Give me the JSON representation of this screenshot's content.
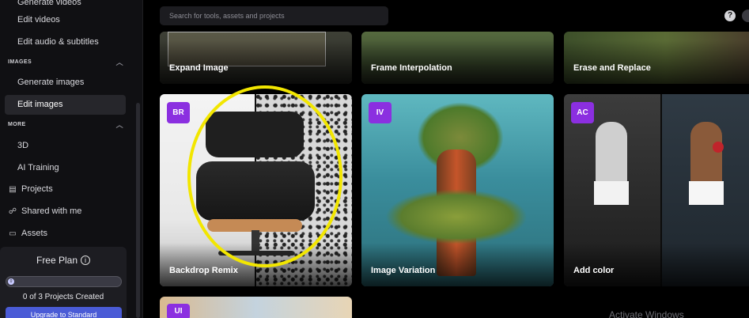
{
  "sidebar": {
    "cut_item": "Generate videos",
    "items_top": [
      "Edit videos",
      "Edit audio & subtitles"
    ],
    "images_section": "IMAGES",
    "images_items": [
      "Generate images",
      "Edit images"
    ],
    "more_section": "MORE",
    "more_items": [
      "3D",
      "AI Training"
    ],
    "icon_items": [
      {
        "icon": "projects-icon",
        "glyph": "▤",
        "label": "Projects"
      },
      {
        "icon": "shared-icon",
        "glyph": "☍",
        "label": "Shared with me"
      },
      {
        "icon": "folder-icon",
        "glyph": "▭",
        "label": "Assets"
      }
    ],
    "plan": {
      "title": "Free Plan",
      "progress_label": "0",
      "progress_fraction": 0,
      "projects_created": "0 of 3 Projects Created",
      "upgrade_label": "Upgrade to Standard"
    }
  },
  "search": {
    "placeholder": "Search for tools, assets and projects"
  },
  "header": {
    "help_glyph": "?"
  },
  "tools": {
    "row1": [
      "Expand Image",
      "Frame Interpolation",
      "Erase and Replace"
    ],
    "row2": [
      {
        "badge": "BR",
        "label": "Backdrop Remix"
      },
      {
        "badge": "IV",
        "label": "Image Variation"
      },
      {
        "badge": "AC",
        "label": "Add color"
      }
    ],
    "row3": [
      {
        "badge": "UI"
      }
    ]
  },
  "colors": {
    "badge": "#8b2fe0",
    "annotation": "#f2e600",
    "upgrade": "#4a5bd6"
  },
  "watermark": "Activate Windows"
}
